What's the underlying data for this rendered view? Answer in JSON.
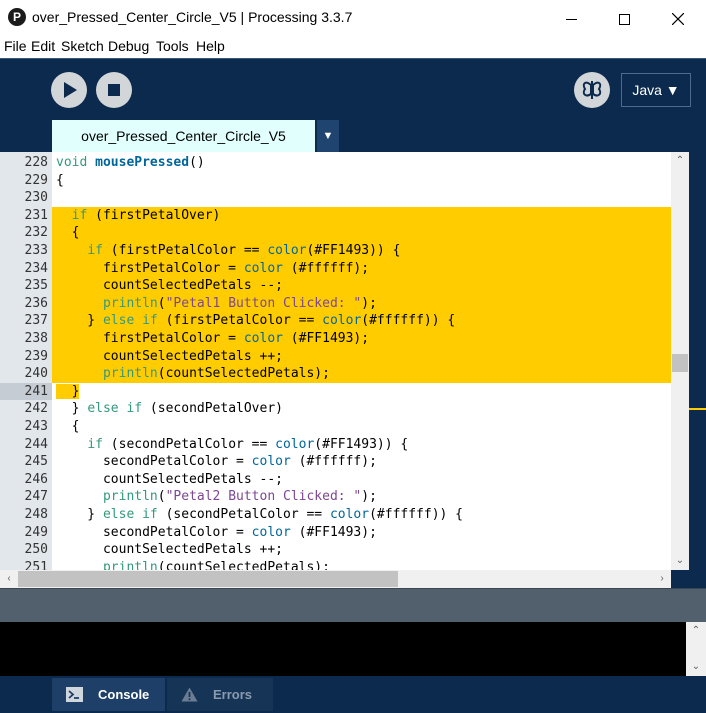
{
  "window": {
    "title": "over_Pressed_Center_Circle_V5 | Processing 3.3.7",
    "icon_glyph": "P"
  },
  "menu": [
    "File",
    "Edit",
    "Sketch",
    "Debug",
    "Tools",
    "Help"
  ],
  "toolbar": {
    "mode": "Java ▼"
  },
  "tab": {
    "name": "over_Pressed_Center_Circle_V5",
    "menu_glyph": "▼"
  },
  "editor": {
    "current_line": 241,
    "lines": [
      {
        "n": "228",
        "code": "void mousePressed()"
      },
      {
        "n": "229",
        "code": "{"
      },
      {
        "n": "230",
        "code": ""
      },
      {
        "n": "231",
        "code": "  if (firstPetalOver)"
      },
      {
        "n": "232",
        "code": "  {"
      },
      {
        "n": "233",
        "code": "    if (firstPetalColor == color(#FF1493)) {"
      },
      {
        "n": "234",
        "code": "      firstPetalColor = color (#ffffff);"
      },
      {
        "n": "235",
        "code": "      countSelectedPetals --;"
      },
      {
        "n": "236",
        "code": "      println(\"Petal1 Button Clicked: \");"
      },
      {
        "n": "237",
        "code": "    } else if (firstPetalColor == color(#ffffff)) {"
      },
      {
        "n": "238",
        "code": "      firstPetalColor = color (#FF1493);"
      },
      {
        "n": "239",
        "code": "      countSelectedPetals ++;"
      },
      {
        "n": "240",
        "code": "      println(countSelectedPetals);"
      },
      {
        "n": "241",
        "code": "  }"
      },
      {
        "n": "242",
        "code": "  } else if (secondPetalOver)"
      },
      {
        "n": "243",
        "code": "  {"
      },
      {
        "n": "244",
        "code": "    if (secondPetalColor == color(#FF1493)) {"
      },
      {
        "n": "245",
        "code": "      secondPetalColor = color (#ffffff);"
      },
      {
        "n": "246",
        "code": "      countSelectedPetals --;"
      },
      {
        "n": "247",
        "code": "      println(\"Petal2 Button Clicked: \");"
      },
      {
        "n": "248",
        "code": "    } else if (secondPetalColor == color(#ffffff)) {"
      },
      {
        "n": "249",
        "code": "      secondPetalColor = color (#FF1493);"
      },
      {
        "n": "250",
        "code": "      countSelectedPetals ++;"
      },
      {
        "n": "251",
        "code": "      println(countSelectedPetals);"
      }
    ]
  },
  "bottom_tabs": {
    "console": "Console",
    "errors": "Errors"
  },
  "colors": {
    "chrome": "#0b2a4d",
    "selection": "#ffcc00",
    "tab_active": "#e0fffd"
  }
}
